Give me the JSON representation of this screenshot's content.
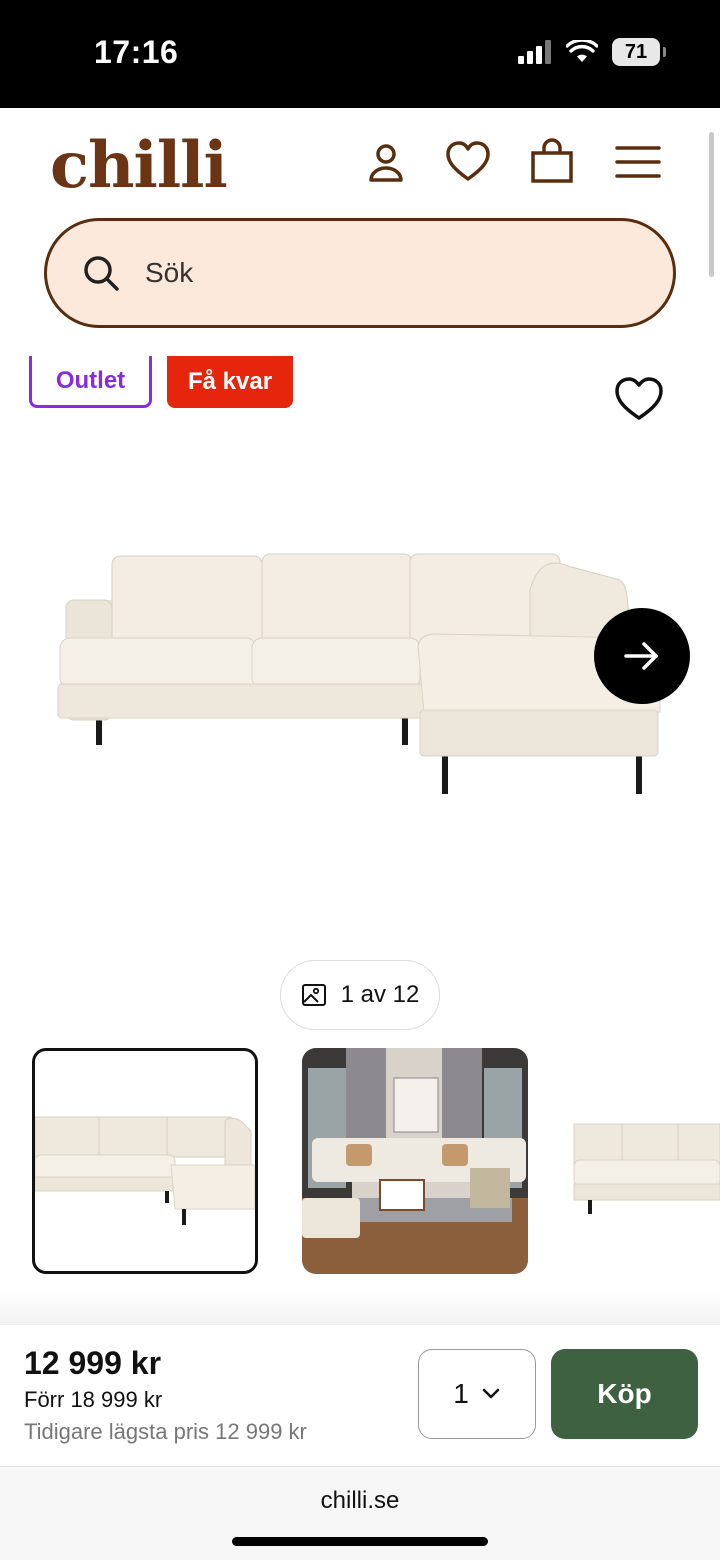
{
  "status_bar": {
    "time": "17:16",
    "battery": "71"
  },
  "header": {
    "logo": "chilli"
  },
  "search": {
    "placeholder": "Sök"
  },
  "badges": {
    "outlet": "Outlet",
    "few_left": "Få kvar"
  },
  "gallery": {
    "counter": "1 av 12"
  },
  "purchase": {
    "price": "12 999 kr",
    "previous_price": "Förr 18 999 kr",
    "lowest_price": "Tidigare lägsta pris 12 999 kr",
    "quantity": "1",
    "buy_label": "Köp"
  },
  "browser": {
    "url": "chilli.se"
  },
  "colors": {
    "brand": "#6b3414",
    "search_bg": "#fde9dc",
    "outlet": "#8a2be2",
    "few_left": "#e5260c",
    "buy": "#3e6141"
  }
}
